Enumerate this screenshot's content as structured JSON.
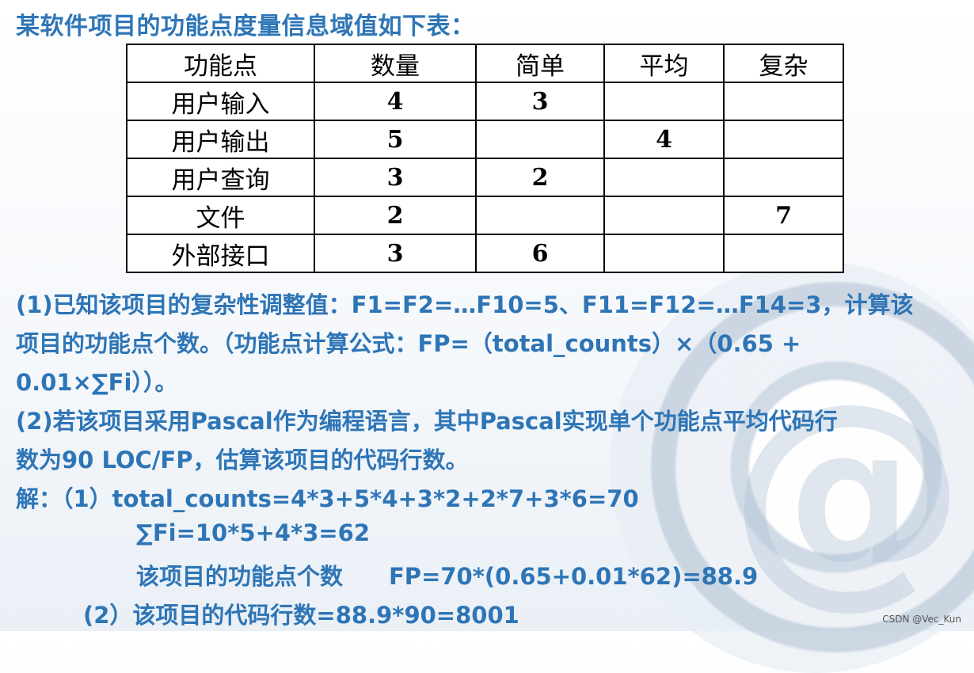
{
  "title": "某软件项目的功能点度量信息域值如下表：",
  "table": {
    "headers": [
      "功能点",
      "数量",
      "简单",
      "平均",
      "复杂"
    ],
    "rows": [
      [
        "用户输入",
        "4",
        "3",
        "",
        ""
      ],
      [
        "用户输出",
        "5",
        "",
        "4",
        ""
      ],
      [
        "用户查询",
        "3",
        "2",
        "",
        ""
      ],
      [
        "文件",
        "2",
        "",
        "",
        "7"
      ],
      [
        "外部接口",
        "3",
        "6",
        "",
        ""
      ]
    ]
  },
  "question": {
    "q1_line1": "(1)已知该项目的复杂性调整值：F1=F2=…F10=5、F11=F12=…F14=3，计算该",
    "q1_line2": "项目的功能点个数。（功能点计算公式：FP=（total_counts）×（0.65 +",
    "q1_line3": "0.01×∑Fi））。",
    "q2_line1": "(2)若该项目采用Pascal作为编程语言，其中Pascal实现单个功能点平均代码行",
    "q2_line2": "数为90 LOC/FP，估算该项目的代码行数。"
  },
  "solution": {
    "line1": "解：（1）total_counts=4*3+5*4+3*2+2*7+3*6=70",
    "line2": "∑Fi=10*5+4*3=62",
    "line3": "该项目的功能点个数　　FP=70*(0.65+0.01*62)=88.9",
    "line4": "(2）该项目的代码行数=88.9*90=8001"
  },
  "watermark": "CSDN @Vec_Kun",
  "colors": {
    "text_blue": "#2e75b6"
  }
}
